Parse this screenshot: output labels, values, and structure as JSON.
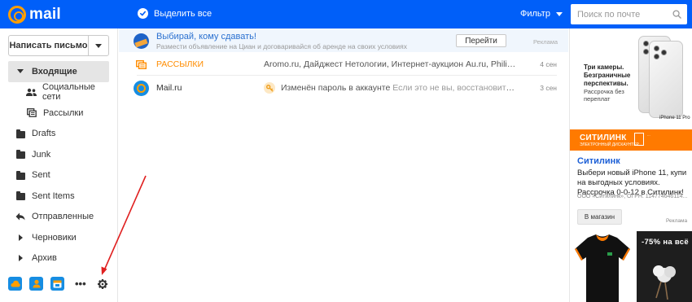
{
  "header": {
    "logo_text": "mail",
    "select_all_label": "Выделить все",
    "filter_label": "Фильтр",
    "search_placeholder": "Поиск по почте"
  },
  "sidebar": {
    "compose_label": "Написать письмо",
    "items": [
      {
        "label": "Входящие",
        "active": true,
        "icon": "chevron-down-icon"
      },
      {
        "label": "Социальные сети",
        "icon": "people-icon"
      },
      {
        "label": "Рассылки",
        "icon": "newsletter-icon"
      },
      {
        "label": "Drafts",
        "icon": "folder-icon"
      },
      {
        "label": "Junk",
        "icon": "folder-icon"
      },
      {
        "label": "Sent",
        "icon": "folder-icon"
      },
      {
        "label": "Sent Items",
        "icon": "folder-icon"
      },
      {
        "label": "Отправленные",
        "icon": "reply-icon"
      },
      {
        "label": "Черновики",
        "icon": "chevron-right-icon"
      },
      {
        "label": "Архив",
        "icon": "chevron-right-icon"
      }
    ],
    "bottom_more_label": "•••"
  },
  "mail_list": {
    "ad": {
      "title": "Выбирай, кому сдавать!",
      "subtitle": "Размести объявление на Циан и договаривайся об аренде на своих условиях",
      "button_label": "Перейти",
      "ad_label": "Реклама"
    },
    "messages": [
      {
        "sender": "РАССЫЛКИ",
        "subject": "Aromo.ru, Дайджест Нетологии, Интернет-аукцион Au.ru, Philip Morris, Mi...",
        "snippet": "",
        "date": "4 сен"
      },
      {
        "sender": "Mail.ru",
        "subject": "Изменён пароль в аккаунте",
        "snippet": "Если это не вы, восстановите до...",
        "date": "3 сен"
      }
    ]
  },
  "right_ads": {
    "iphone": {
      "headline": "Три камеры. Безграничные перспективы.",
      "sub": "Рассрочка без переплат",
      "model": "iPhone 11 Pro"
    },
    "citilink": {
      "logo": "СИТИЛИНК",
      "tagline": "ЭЛЕКТРОННЫЙ ДИСКАУНТЕР",
      "fine_print": "...",
      "title": "Ситилинк",
      "body": "Выбери новый iPhone 11, купи на выгодных условиях. Рассрочка 0-0-12 в Ситилинк!",
      "org": "ООО «Ситилинк», ОГРН: 114774646114...",
      "button_label": "В магазин",
      "ad_label": "Реклама"
    },
    "promo_text": "-75% на всё"
  },
  "colors": {
    "header_bg": "#005ff9",
    "logo_accent": "#ff9e00",
    "link_blue": "#2a70d0",
    "newsletter_orange": "#ff8c00",
    "citilink_orange": "#ff7a00",
    "annotation_red": "#e02020"
  }
}
